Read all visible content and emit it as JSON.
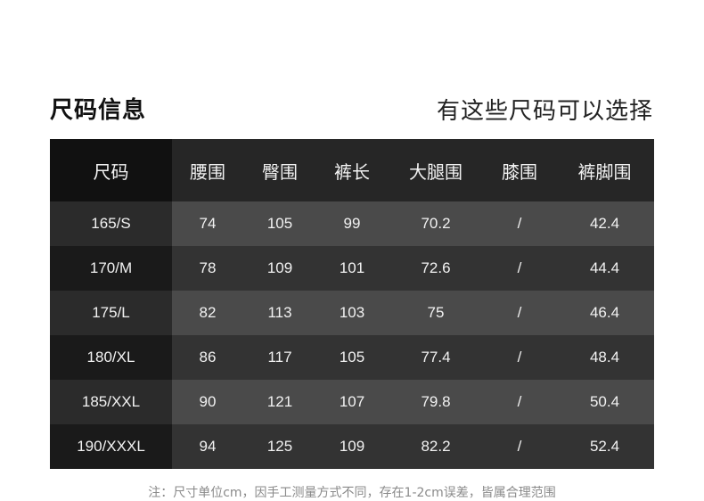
{
  "title": "尺码信息",
  "subtitle": "有这些尺码可以选择",
  "table": {
    "headers": [
      "尺码",
      "腰围",
      "臀围",
      "裤长",
      "大腿围",
      "膝围",
      "裤脚围"
    ],
    "rows": [
      [
        "165/S",
        "74",
        "105",
        "99",
        "70.2",
        "/",
        "42.4"
      ],
      [
        "170/M",
        "78",
        "109",
        "101",
        "72.6",
        "/",
        "44.4"
      ],
      [
        "175/L",
        "82",
        "113",
        "103",
        "75",
        "/",
        "46.4"
      ],
      [
        "180/XL",
        "86",
        "117",
        "105",
        "77.4",
        "/",
        "48.4"
      ],
      [
        "185/XXL",
        "90",
        "121",
        "107",
        "79.8",
        "/",
        "50.4"
      ],
      [
        "190/XXXL",
        "94",
        "125",
        "109",
        "82.2",
        "/",
        "52.4"
      ]
    ]
  },
  "note": "注：尺寸单位cm，因手工测量方式不同，存在1-2cm误差，皆属合理范围"
}
